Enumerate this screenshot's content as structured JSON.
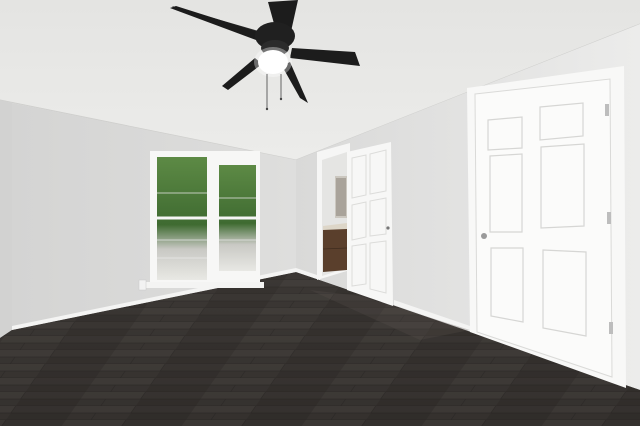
{
  "scene": {
    "type": "empty-bedroom",
    "features": [
      "vaulted-textured-ceiling",
      "ceiling-fan-with-light",
      "double-window",
      "open-doorway-to-bathroom",
      "closet-door",
      "dark-wood-laminate-floor"
    ]
  },
  "colors": {
    "ceiling": "#e6e6e4",
    "wall_left": "#dcdcdb",
    "wall_right": "#e9e9e8",
    "wall_back": "#d8d8d7",
    "trim": "#f6f6f6",
    "floor_dark": "#2e2b29",
    "floor_mid": "#4a4541",
    "fan_blade": "#1c1c1c",
    "fan_light": "#ffffff",
    "foliage": "#4f7a3a",
    "vanity": "#5a3f2c"
  }
}
